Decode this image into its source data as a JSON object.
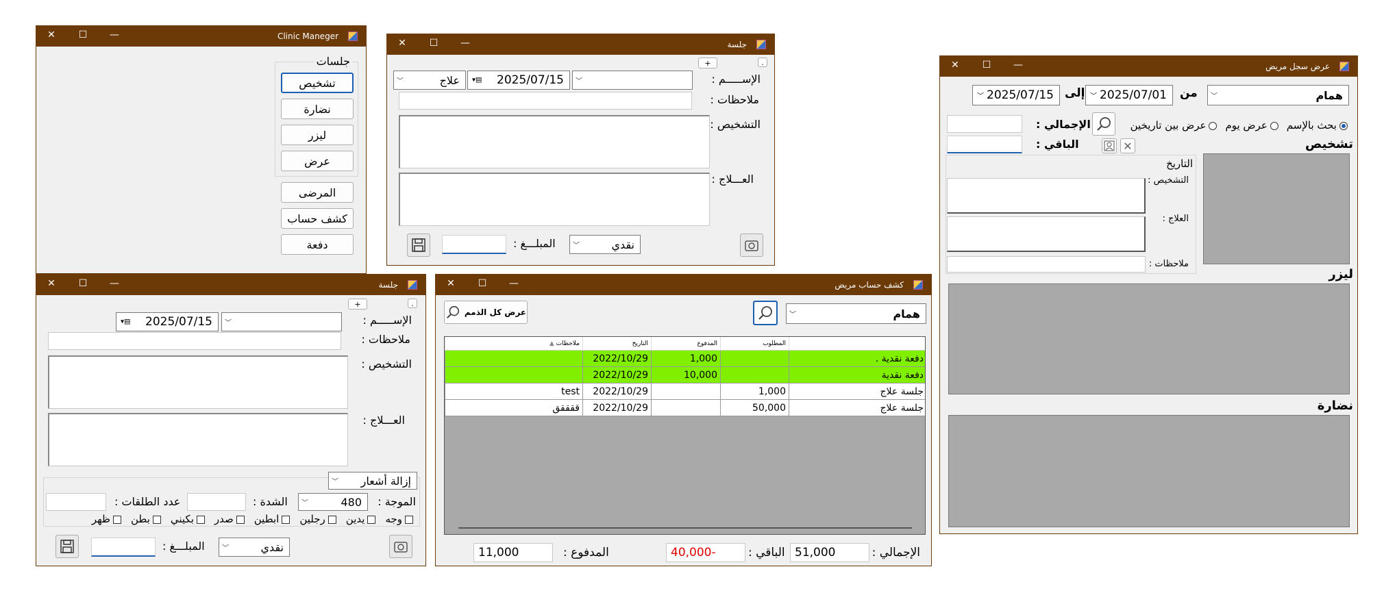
{
  "colors": {
    "titlebar": "#6b3a06",
    "highlight": "#80f000",
    "negative": "#e00000"
  },
  "win_clinic": {
    "title": "Clinic Maneger",
    "group_label": "جلسات",
    "btn_diagnosis": "تشخيص",
    "btn_glasses": "نضارة",
    "btn_laser": "ليزر",
    "btn_view": "عرض",
    "btn_patients": "المرضى",
    "btn_statement": "كشف حساب",
    "btn_payment": "دفعة"
  },
  "win_session1": {
    "title": "جلسة",
    "small_btn_dot": ".",
    "small_btn_plus": "+",
    "name_label": "الإســـــم :",
    "date": "2025/07/15",
    "type": "علاج",
    "notes_label": "ملاحظات :",
    "diagnosis_label": "التشخيص :",
    "treatment_label": "العـــلاج :",
    "amount_label": "المبلـــغ :",
    "payment_type": "نقدي"
  },
  "win_session2": {
    "title": "جلسة",
    "small_btn_dot": ".",
    "small_btn_plus": "+",
    "name_label": "الإســـــم :",
    "date": "2025/07/15",
    "notes_label": "ملاحظات :",
    "diagnosis_label": "التشخيص :",
    "treatment_label": "العـــلاج :",
    "procedure": "إزالة أشعار",
    "wave_label": "الموجة :",
    "wave_value": "480",
    "intensity_label": "الشدة :",
    "shots_label": "عدد الطلقات :",
    "areas": [
      "وجه",
      "يدين",
      "رجلين",
      "ابطين",
      "صدر",
      "بكيني",
      "بطن",
      "ظهر"
    ],
    "amount_label": "المبلـــغ :",
    "payment_type": "نقدي"
  },
  "win_statement": {
    "title": "كشف حساب مريض",
    "patient": "همام",
    "show_all_btn": "عرض كل الذمم",
    "columns": [
      "المطلوب",
      "المدفوع",
      "التاريخ",
      "ملاحظات"
    ],
    "rows": [
      {
        "desc": "دفعة نقدية .",
        "required": "",
        "paid": "1,000",
        "date": "2022/10/29",
        "notes": "",
        "hl": true
      },
      {
        "desc": "دفعة نقدية",
        "required": "",
        "paid": "10,000",
        "date": "2022/10/29",
        "notes": "",
        "hl": true
      },
      {
        "desc": "جلسة علاج",
        "required": "1,000",
        "paid": "",
        "date": "2022/10/29",
        "notes": "test",
        "hl": false
      },
      {
        "desc": "جلسة علاج",
        "required": "50,000",
        "paid": "",
        "date": "2022/10/29",
        "notes": "ققققق",
        "hl": false
      }
    ],
    "total_label": "الإجمالي :",
    "total_value": "51,000",
    "remaining_label": "الباقي :",
    "remaining_value": "40,000-",
    "paid_label": "المدفوع :",
    "paid_value": "11,000"
  },
  "win_record": {
    "title": "عرض سجل مريض",
    "patient": "همام",
    "from_label": "من",
    "from_date": "2025/07/01",
    "to_label": "إلى",
    "to_date": "2025/07/15",
    "radio_name": "بحث بالإسم",
    "radio_day": "عرض يوم",
    "radio_between": "عرض بين تاريخين",
    "total_label": "الإجمالي :",
    "remaining_label": "الباقي :",
    "section_diagnosis": "تشخيص",
    "date_label": "التاريخ",
    "diagnosis_label": "التشخيص :",
    "treatment_label": "العلاج :",
    "notes_label": "ملاحظات :",
    "section_laser": "ليزر",
    "section_glasses": "نضارة"
  }
}
